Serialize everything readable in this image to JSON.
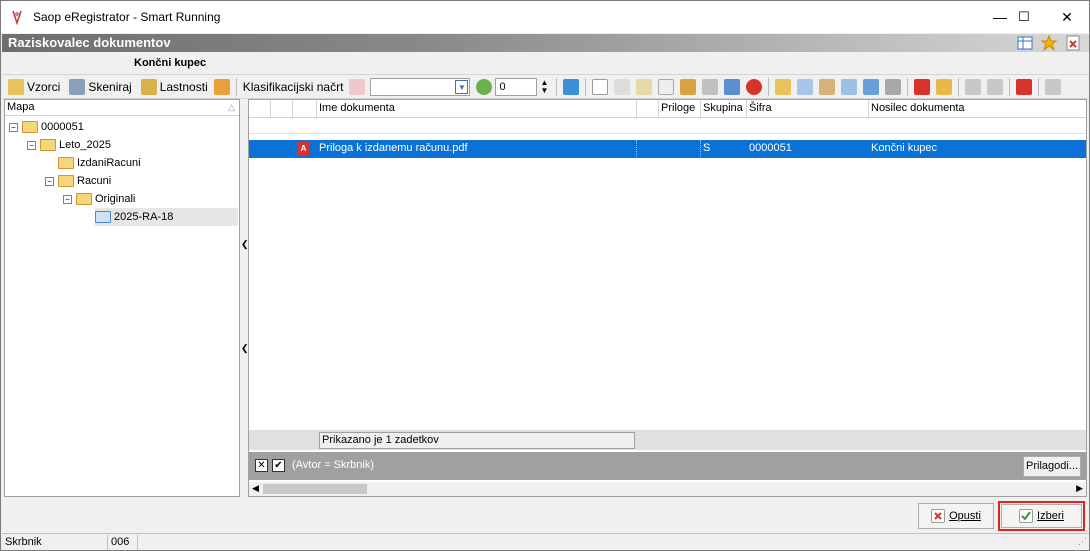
{
  "window": {
    "title": "Saop eRegistrator - Smart Running",
    "minimize": "—",
    "maximize": "☐",
    "close": "✕"
  },
  "header": {
    "title": "Raziskovalec dokumentov",
    "subtitle": "Končni kupec"
  },
  "toolbar": {
    "vzorci": "Vzorci",
    "skeniraj": "Skeniraj",
    "lastnosti": "Lastnosti",
    "klasifikacijski_nacrt": "Klasifikacijski načrt",
    "combo_value": "",
    "spin_value": "0"
  },
  "tree": {
    "header": "Mapa",
    "items": [
      {
        "label": "0000051",
        "expander": "⊟"
      },
      {
        "label": "Leto_2025",
        "expander": "⊟"
      },
      {
        "label": "IzdaniRacuni",
        "expander": ""
      },
      {
        "label": "Racuni",
        "expander": "⊟"
      },
      {
        "label": "Originali",
        "expander": "⊟"
      },
      {
        "label": "2025-RA-18",
        "expander": ""
      }
    ]
  },
  "grid": {
    "columns": {
      "ime": "Ime dokumenta",
      "priloge": "Priloge",
      "skupina": "Skupina",
      "sifra": "Šifra",
      "nosilec": "Nosilec dokumenta"
    },
    "rows": [
      {
        "ime": "Priloga k izdanemu računu.pdf",
        "priloge": "",
        "skupina": "S",
        "sifra": "0000051",
        "nosilec": "Končni kupec"
      }
    ],
    "count_text": "Prikazano je 1 zadetkov",
    "filter_text": "(Avtor = Skrbnik)",
    "prilagodi": "Prilagodi..."
  },
  "buttons": {
    "opusti": "Opusti",
    "izberi": "Izberi"
  },
  "statusbar": {
    "user": "Skrbnik",
    "code": "006"
  },
  "colors": {
    "selection": "#0a72d6",
    "highlight_border": "#e0221b"
  }
}
